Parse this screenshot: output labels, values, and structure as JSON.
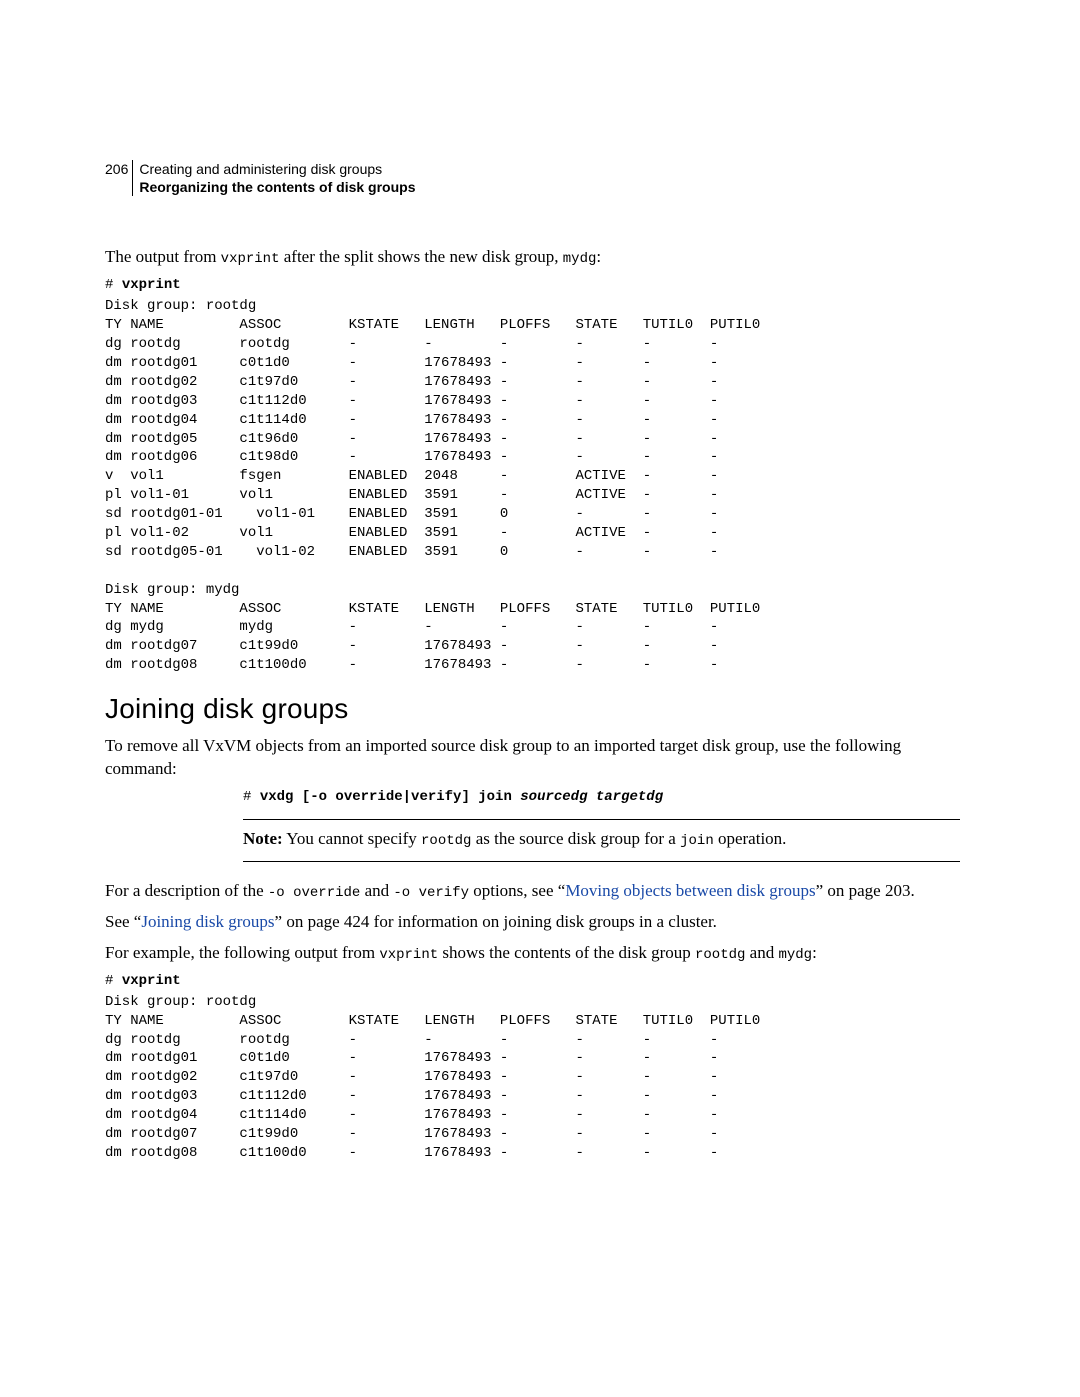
{
  "page_number": "206",
  "header": {
    "title": "Creating and administering disk groups",
    "subtitle": "Reorganizing the contents of disk groups"
  },
  "intro1_a": "The output from ",
  "intro1_cmd": "vxprint",
  "intro1_b": " after the split shows the new disk group, ",
  "intro1_c": "mydg",
  "intro1_d": ":",
  "vxprint1_prompt": "# ",
  "vxprint1_cmd": "vxprint",
  "vxprint1_body": "Disk group: rootdg\nTY NAME         ASSOC        KSTATE   LENGTH   PLOFFS   STATE   TUTIL0  PUTIL0\ndg rootdg       rootdg       -        -        -        -       -       -\ndm rootdg01     c0t1d0       -        17678493 -        -       -       -\ndm rootdg02     c1t97d0      -        17678493 -        -       -       -\ndm rootdg03     c1t112d0     -        17678493 -        -       -       -\ndm rootdg04     c1t114d0     -        17678493 -        -       -       -\ndm rootdg05     c1t96d0      -        17678493 -        -       -       -\ndm rootdg06     c1t98d0      -        17678493 -        -       -       -\nv  vol1         fsgen        ENABLED  2048     -        ACTIVE  -       -\npl vol1-01      vol1         ENABLED  3591     -        ACTIVE  -       -\nsd rootdg01-01    vol1-01    ENABLED  3591     0        -       -       -\npl vol1-02      vol1         ENABLED  3591     -        ACTIVE  -       -\nsd rootdg05-01    vol1-02    ENABLED  3591     0        -       -       -\n\nDisk group: mydg\nTY NAME         ASSOC        KSTATE   LENGTH   PLOFFS   STATE   TUTIL0  PUTIL0\ndg mydg         mydg         -        -        -        -       -       -\ndm rootdg07     c1t99d0      -        17678493 -        -       -       -\ndm rootdg08     c1t100d0     -        17678493 -        -       -       -",
  "heading2": "Joining disk groups",
  "join_para": "To remove all VxVM objects from an imported source disk group to an imported target disk group, use the following command:",
  "join_cmd_prompt": "# ",
  "join_cmd_bold": "vxdg [-o override|verify] join ",
  "join_cmd_args": "sourcedg targetdg",
  "note_label": "Note:",
  "note_a": " You cannot specify ",
  "note_cmd1": "rootdg",
  "note_b": " as the source disk group for a ",
  "note_cmd2": "join",
  "note_c": " operation.",
  "desc_a": "For a description of the ",
  "desc_cmd1": "-o override",
  "desc_b": " and ",
  "desc_cmd2": "-o verify",
  "desc_c": " options, see “",
  "link1": "Moving objects between disk groups",
  "desc_d": "” on page 203.",
  "see_a": "See “",
  "link2": "Joining disk groups",
  "see_b": "” on page 424 for information on joining disk groups in a cluster.",
  "ex_a": "For example, the following output from ",
  "ex_cmd": "vxprint",
  "ex_b": " shows the contents of the disk group ",
  "ex_c": "rootdg",
  "ex_d": " and ",
  "ex_e": "mydg",
  "ex_f": ":",
  "vxprint2_prompt": "# ",
  "vxprint2_cmd": "vxprint",
  "vxprint2_body": "Disk group: rootdg\nTY NAME         ASSOC        KSTATE   LENGTH   PLOFFS   STATE   TUTIL0  PUTIL0\ndg rootdg       rootdg       -        -        -        -       -       -\ndm rootdg01     c0t1d0       -        17678493 -        -       -       -\ndm rootdg02     c1t97d0      -        17678493 -        -       -       -\ndm rootdg03     c1t112d0     -        17678493 -        -       -       -\ndm rootdg04     c1t114d0     -        17678493 -        -       -       -\ndm rootdg07     c1t99d0      -        17678493 -        -       -       -\ndm rootdg08     c1t100d0     -        17678493 -        -       -       -"
}
